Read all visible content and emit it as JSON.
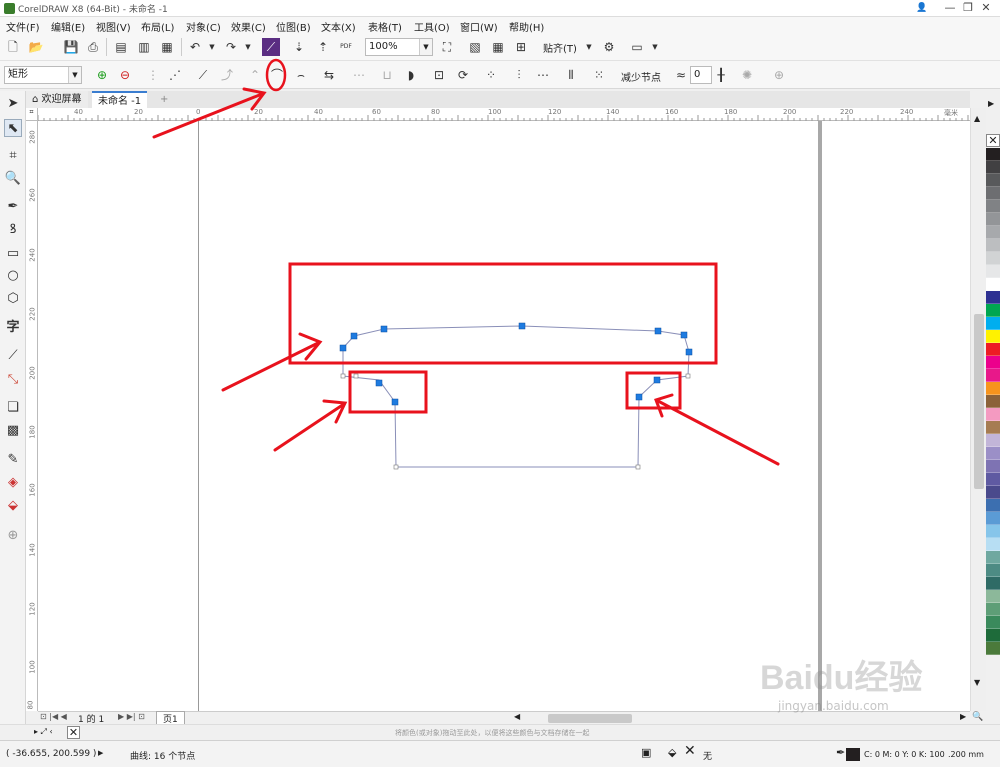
{
  "window": {
    "title": "CorelDRAW X8 (64-Bit) - 未命名 -1",
    "minimize": "—",
    "restore": "❐",
    "close": "✕",
    "help_icon": "👤"
  },
  "menu": [
    "文件(F)",
    "编辑(E)",
    "视图(V)",
    "布局(L)",
    "对象(C)",
    "效果(C)",
    "位图(B)",
    "文本(X)",
    "表格(T)",
    "工具(O)",
    "窗口(W)",
    "帮助(H)"
  ],
  "toolbar": {
    "zoom": "100%",
    "snap_label": "贴齐(T)",
    "pdf_label": "PDF"
  },
  "property_bar": {
    "shape_select": "矩形",
    "reduce_nodes": "减少节点",
    "smoothness": "0"
  },
  "tabs": [
    {
      "label": "欢迎屏幕"
    },
    {
      "label": "未命名 -1"
    }
  ],
  "rulers": {
    "h_labels": [
      "40",
      "20",
      "0",
      "20",
      "40",
      "60",
      "80",
      "100",
      "120",
      "140",
      "160",
      "180",
      "200",
      "220",
      "240"
    ],
    "h_unit": "毫米",
    "v_labels": [
      "280",
      "260",
      "240",
      "220",
      "200",
      "180",
      "160",
      "140",
      "120",
      "100",
      "80"
    ],
    "v_unit": "毫米"
  },
  "page_nav": {
    "page_of": "1 的 1",
    "page_tab": "页1"
  },
  "doc_palette_hint": "将颜色(或对象)拖动至此处，以便将这些颜色与文档存储在一起",
  "status": {
    "coords": "( -36.655, 200.599 )",
    "info": "曲线: 16 个节点",
    "fill_label": "无",
    "outline_info": "C: 0 M: 0 Y: 0 K: 100",
    "outline_width": ".200 mm"
  },
  "palette_colors": [
    "#231f20",
    "#414042",
    "#58595b",
    "#6d6e71",
    "#808285",
    "#939598",
    "#a7a9ac",
    "#bcbec0",
    "#d1d3d4",
    "#e6e7e8",
    "#ffffff",
    "#2e3192",
    "#00a651",
    "#00aeef",
    "#fff200",
    "#ed1c24",
    "#ec008c",
    "#e8188a",
    "#f7941d",
    "#8c6239",
    "#f49ac1",
    "#a67c52",
    "#c2b5d8",
    "#9b8fc7",
    "#7e73b3",
    "#5f5aa2",
    "#4a4a8c",
    "#3c6fb0",
    "#5b9bd5",
    "#86c5ea",
    "#b7def3",
    "#6fa8a0",
    "#4d8b84",
    "#2f6b66",
    "#8cb89a",
    "#5e9e77",
    "#3a8a5c",
    "#1e6b3a",
    "#4b7a3b"
  ],
  "watermark": {
    "brand": "Baidu经验",
    "url": "jingyan.baidu.com"
  },
  "annotation_color": "#e8121d",
  "node_color": "#1e7be0"
}
